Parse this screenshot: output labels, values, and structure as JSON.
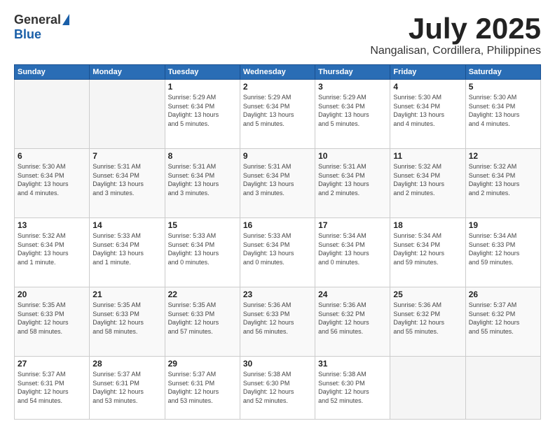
{
  "header": {
    "logo_general": "General",
    "logo_blue": "Blue",
    "title": "July 2025",
    "location": "Nangalisan, Cordillera, Philippines"
  },
  "weekdays": [
    "Sunday",
    "Monday",
    "Tuesday",
    "Wednesday",
    "Thursday",
    "Friday",
    "Saturday"
  ],
  "weeks": [
    [
      {
        "day": "",
        "detail": ""
      },
      {
        "day": "",
        "detail": ""
      },
      {
        "day": "1",
        "detail": "Sunrise: 5:29 AM\nSunset: 6:34 PM\nDaylight: 13 hours\nand 5 minutes."
      },
      {
        "day": "2",
        "detail": "Sunrise: 5:29 AM\nSunset: 6:34 PM\nDaylight: 13 hours\nand 5 minutes."
      },
      {
        "day": "3",
        "detail": "Sunrise: 5:29 AM\nSunset: 6:34 PM\nDaylight: 13 hours\nand 5 minutes."
      },
      {
        "day": "4",
        "detail": "Sunrise: 5:30 AM\nSunset: 6:34 PM\nDaylight: 13 hours\nand 4 minutes."
      },
      {
        "day": "5",
        "detail": "Sunrise: 5:30 AM\nSunset: 6:34 PM\nDaylight: 13 hours\nand 4 minutes."
      }
    ],
    [
      {
        "day": "6",
        "detail": "Sunrise: 5:30 AM\nSunset: 6:34 PM\nDaylight: 13 hours\nand 4 minutes."
      },
      {
        "day": "7",
        "detail": "Sunrise: 5:31 AM\nSunset: 6:34 PM\nDaylight: 13 hours\nand 3 minutes."
      },
      {
        "day": "8",
        "detail": "Sunrise: 5:31 AM\nSunset: 6:34 PM\nDaylight: 13 hours\nand 3 minutes."
      },
      {
        "day": "9",
        "detail": "Sunrise: 5:31 AM\nSunset: 6:34 PM\nDaylight: 13 hours\nand 3 minutes."
      },
      {
        "day": "10",
        "detail": "Sunrise: 5:31 AM\nSunset: 6:34 PM\nDaylight: 13 hours\nand 2 minutes."
      },
      {
        "day": "11",
        "detail": "Sunrise: 5:32 AM\nSunset: 6:34 PM\nDaylight: 13 hours\nand 2 minutes."
      },
      {
        "day": "12",
        "detail": "Sunrise: 5:32 AM\nSunset: 6:34 PM\nDaylight: 13 hours\nand 2 minutes."
      }
    ],
    [
      {
        "day": "13",
        "detail": "Sunrise: 5:32 AM\nSunset: 6:34 PM\nDaylight: 13 hours\nand 1 minute."
      },
      {
        "day": "14",
        "detail": "Sunrise: 5:33 AM\nSunset: 6:34 PM\nDaylight: 13 hours\nand 1 minute."
      },
      {
        "day": "15",
        "detail": "Sunrise: 5:33 AM\nSunset: 6:34 PM\nDaylight: 13 hours\nand 0 minutes."
      },
      {
        "day": "16",
        "detail": "Sunrise: 5:33 AM\nSunset: 6:34 PM\nDaylight: 13 hours\nand 0 minutes."
      },
      {
        "day": "17",
        "detail": "Sunrise: 5:34 AM\nSunset: 6:34 PM\nDaylight: 13 hours\nand 0 minutes."
      },
      {
        "day": "18",
        "detail": "Sunrise: 5:34 AM\nSunset: 6:34 PM\nDaylight: 12 hours\nand 59 minutes."
      },
      {
        "day": "19",
        "detail": "Sunrise: 5:34 AM\nSunset: 6:33 PM\nDaylight: 12 hours\nand 59 minutes."
      }
    ],
    [
      {
        "day": "20",
        "detail": "Sunrise: 5:35 AM\nSunset: 6:33 PM\nDaylight: 12 hours\nand 58 minutes."
      },
      {
        "day": "21",
        "detail": "Sunrise: 5:35 AM\nSunset: 6:33 PM\nDaylight: 12 hours\nand 58 minutes."
      },
      {
        "day": "22",
        "detail": "Sunrise: 5:35 AM\nSunset: 6:33 PM\nDaylight: 12 hours\nand 57 minutes."
      },
      {
        "day": "23",
        "detail": "Sunrise: 5:36 AM\nSunset: 6:33 PM\nDaylight: 12 hours\nand 56 minutes."
      },
      {
        "day": "24",
        "detail": "Sunrise: 5:36 AM\nSunset: 6:32 PM\nDaylight: 12 hours\nand 56 minutes."
      },
      {
        "day": "25",
        "detail": "Sunrise: 5:36 AM\nSunset: 6:32 PM\nDaylight: 12 hours\nand 55 minutes."
      },
      {
        "day": "26",
        "detail": "Sunrise: 5:37 AM\nSunset: 6:32 PM\nDaylight: 12 hours\nand 55 minutes."
      }
    ],
    [
      {
        "day": "27",
        "detail": "Sunrise: 5:37 AM\nSunset: 6:31 PM\nDaylight: 12 hours\nand 54 minutes."
      },
      {
        "day": "28",
        "detail": "Sunrise: 5:37 AM\nSunset: 6:31 PM\nDaylight: 12 hours\nand 53 minutes."
      },
      {
        "day": "29",
        "detail": "Sunrise: 5:37 AM\nSunset: 6:31 PM\nDaylight: 12 hours\nand 53 minutes."
      },
      {
        "day": "30",
        "detail": "Sunrise: 5:38 AM\nSunset: 6:30 PM\nDaylight: 12 hours\nand 52 minutes."
      },
      {
        "day": "31",
        "detail": "Sunrise: 5:38 AM\nSunset: 6:30 PM\nDaylight: 12 hours\nand 52 minutes."
      },
      {
        "day": "",
        "detail": ""
      },
      {
        "day": "",
        "detail": ""
      }
    ]
  ]
}
